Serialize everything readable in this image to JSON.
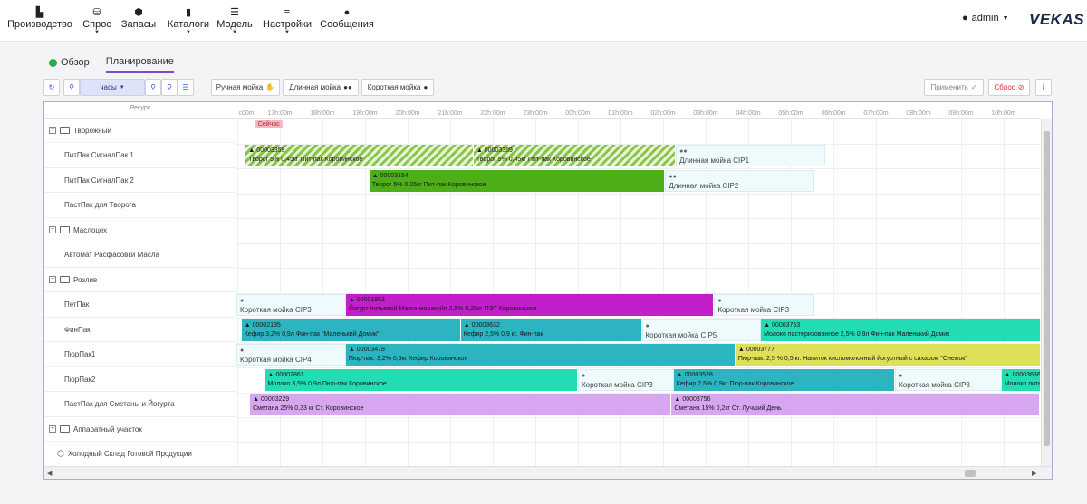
{
  "nav": {
    "items": [
      {
        "label": "Производство",
        "icon": "factory-icon",
        "glyph": "▙",
        "caret": false
      },
      {
        "label": "Спрос",
        "icon": "basket-icon",
        "glyph": "⛁",
        "caret": true
      },
      {
        "label": "Запасы",
        "icon": "boxes-icon",
        "glyph": "⬢",
        "caret": false
      },
      {
        "label": "Каталоги",
        "icon": "book-icon",
        "glyph": "▮",
        "caret": true
      },
      {
        "label": "Модель",
        "icon": "list-icon",
        "glyph": "☰",
        "caret": true
      },
      {
        "label": "Настройки",
        "icon": "sliders-icon",
        "glyph": "≡",
        "caret": true
      },
      {
        "label": "Сообщения",
        "icon": "chat-icon",
        "glyph": "●",
        "caret": false
      }
    ],
    "user": "admin",
    "logo": "VEKAS"
  },
  "tabs": {
    "overview": "Обзор",
    "planning": "Планирование"
  },
  "toolbar": {
    "scale": "часы",
    "manual_wash": "Ручная мойка",
    "long_wash": "Длинная мойка",
    "short_wash": "Короткая мойка",
    "apply": "Применить",
    "reset": "Сброс"
  },
  "gantt": {
    "resource_header": "Ресурс",
    "now_label": "Сейчас",
    "ticks": [
      "c00m",
      "17h:00m",
      "18h:00m",
      "19h:00m",
      "20h:00m",
      "21h:00m",
      "22h:00m",
      "23h:00m",
      "00h:00m",
      "01h:00m",
      "02h:00m",
      "03h:00m",
      "04h:00m",
      "05h:00m",
      "06h:00m",
      "07h:00m",
      "08h:00m",
      "09h:00m",
      "10h:00m"
    ],
    "rows": [
      {
        "type": "group",
        "label": "Творожный"
      },
      {
        "type": "item",
        "label": "ПитПак СигналПак 1"
      },
      {
        "type": "item",
        "label": "ПитПак СигналПак 2"
      },
      {
        "type": "item",
        "label": "ПастПак для Творога"
      },
      {
        "type": "group",
        "label": "Маслоцех"
      },
      {
        "type": "item",
        "label": "Автомат Расфасовки Масла"
      },
      {
        "type": "group",
        "label": "Розлив"
      },
      {
        "type": "item",
        "label": "ПетПак"
      },
      {
        "type": "item",
        "label": "ФинПак"
      },
      {
        "type": "item",
        "label": "ПюрПак1"
      },
      {
        "type": "item",
        "label": "ПюрПак2"
      },
      {
        "type": "item",
        "label": "ПастПак для Сметаны и Йогурта"
      },
      {
        "type": "group-closed",
        "label": "Аппаратный участок"
      },
      {
        "type": "warehouse",
        "label": "Холодный Склад Готовой Продукции"
      }
    ],
    "bars": [
      {
        "row": 1,
        "start": 0.2,
        "end": 5.55,
        "kind": "hatch",
        "id": "00003359",
        "text": "Творог 5% 0,45кг Пит-пак Коровинское"
      },
      {
        "row": 1,
        "start": 5.55,
        "end": 10.3,
        "kind": "hatch",
        "id": "00003359",
        "text": "Творог 5% 0,45кг Пит-пак Коровинское"
      },
      {
        "row": 1,
        "start": 10.3,
        "end": 13.8,
        "kind": "wash",
        "icon": "drops",
        "id": "",
        "text": "Длинная мойка   CIP1"
      },
      {
        "row": 2,
        "start": 3.1,
        "end": 10.05,
        "kind": "task",
        "color": "#4caf18",
        "id": "00003154",
        "text": "Творог 5% 0,25кг Пит-пак Коровинское"
      },
      {
        "row": 2,
        "start": 10.05,
        "end": 13.55,
        "kind": "wash",
        "icon": "drops",
        "id": "",
        "text": "Длинная мойка   CIP2"
      },
      {
        "row": 7,
        "start": -0.25,
        "end": 2.55,
        "kind": "wash",
        "icon": "drop",
        "id": "",
        "text": "Короткая мойка   CIP3"
      },
      {
        "row": 7,
        "start": 2.55,
        "end": 11.2,
        "kind": "task",
        "color": "#c11fc9",
        "id": "00001953",
        "text": "Йогурт питьевой Манго-маракуйя 2,5% 0,25кг ПЭТ Коровинское"
      },
      {
        "row": 7,
        "start": 11.2,
        "end": 13.55,
        "kind": "wash",
        "icon": "drop",
        "id": "",
        "text": "Короткая мойка   CIP3"
      },
      {
        "row": 8,
        "start": 0.1,
        "end": 5.25,
        "kind": "task",
        "color": "#2cb5c0",
        "id": "00002195",
        "text": "Кефир 3,2% 0,9л Фин-пак \"Маленький Домик\""
      },
      {
        "row": 8,
        "start": 5.25,
        "end": 9.5,
        "kind": "task",
        "color": "#2cb5c0",
        "id": "00003632",
        "text": "Кефир 2,5% 0,9 кг. Фин-пак"
      },
      {
        "row": 8,
        "start": 9.5,
        "end": 12.3,
        "kind": "wash",
        "icon": "drop",
        "id": "",
        "text": "Короткая мойка   CIP5"
      },
      {
        "row": 8,
        "start": 12.3,
        "end": 19.0,
        "kind": "task",
        "color": "#22dcb4",
        "id": "00003753",
        "text": "Молоко пастеризованное 2,5% 0,9л Фин-пак Маленький Домик"
      },
      {
        "row": 9,
        "start": -0.25,
        "end": 2.55,
        "kind": "wash",
        "icon": "drop",
        "id": "",
        "text": "Короткая мойка   CIP4"
      },
      {
        "row": 9,
        "start": 2.55,
        "end": 11.7,
        "kind": "task",
        "color": "#2cb5c0",
        "id": "00003478",
        "text": "Пюр-пак. 3,2% 0,9кг Кефир Коровинское"
      },
      {
        "row": 9,
        "start": 11.7,
        "end": 19.0,
        "kind": "task",
        "color": "#dfe05a",
        "id": "00003777",
        "text": "Пюр-пак. 2,5 % 0,5 кг. Напиток кисломолочный йогуртный с сахаром \"Снежок\""
      },
      {
        "row": 10,
        "start": 0.65,
        "end": 8.0,
        "kind": "task",
        "color": "#22dcb4",
        "id": "00002861",
        "text": "Молоко 3,5% 0,9л Пюр-пак Коровинское"
      },
      {
        "row": 10,
        "start": 8.0,
        "end": 10.25,
        "kind": "wash",
        "icon": "drop",
        "id": "",
        "text": "Короткая мойка   CIP3"
      },
      {
        "row": 10,
        "start": 10.25,
        "end": 15.45,
        "kind": "task",
        "color": "#2cb5c0",
        "id": "00003528",
        "text": "Кефир 2,5% 0,9кг Пюр-пак Коровинское"
      },
      {
        "row": 10,
        "start": 15.45,
        "end": 17.95,
        "kind": "wash",
        "icon": "drop",
        "id": "",
        "text": "Короткая мойка   CIP3"
      },
      {
        "row": 10,
        "start": 17.95,
        "end": 19.0,
        "kind": "task",
        "color": "#22dcb4",
        "id": "00003686",
        "text": "Молоко питьевое"
      },
      {
        "row": 11,
        "start": 0.3,
        "end": 10.2,
        "kind": "task",
        "color": "#d8a6f0",
        "id": "00003229",
        "text": "Сметана 25% 0,33 кг Ст. Коровинское"
      },
      {
        "row": 11,
        "start": 10.2,
        "end": 18.85,
        "kind": "task",
        "color": "#d8a6f0",
        "id": "00003756",
        "text": "Сметана 15% 0,2кг Ст. Лучший День"
      }
    ]
  }
}
